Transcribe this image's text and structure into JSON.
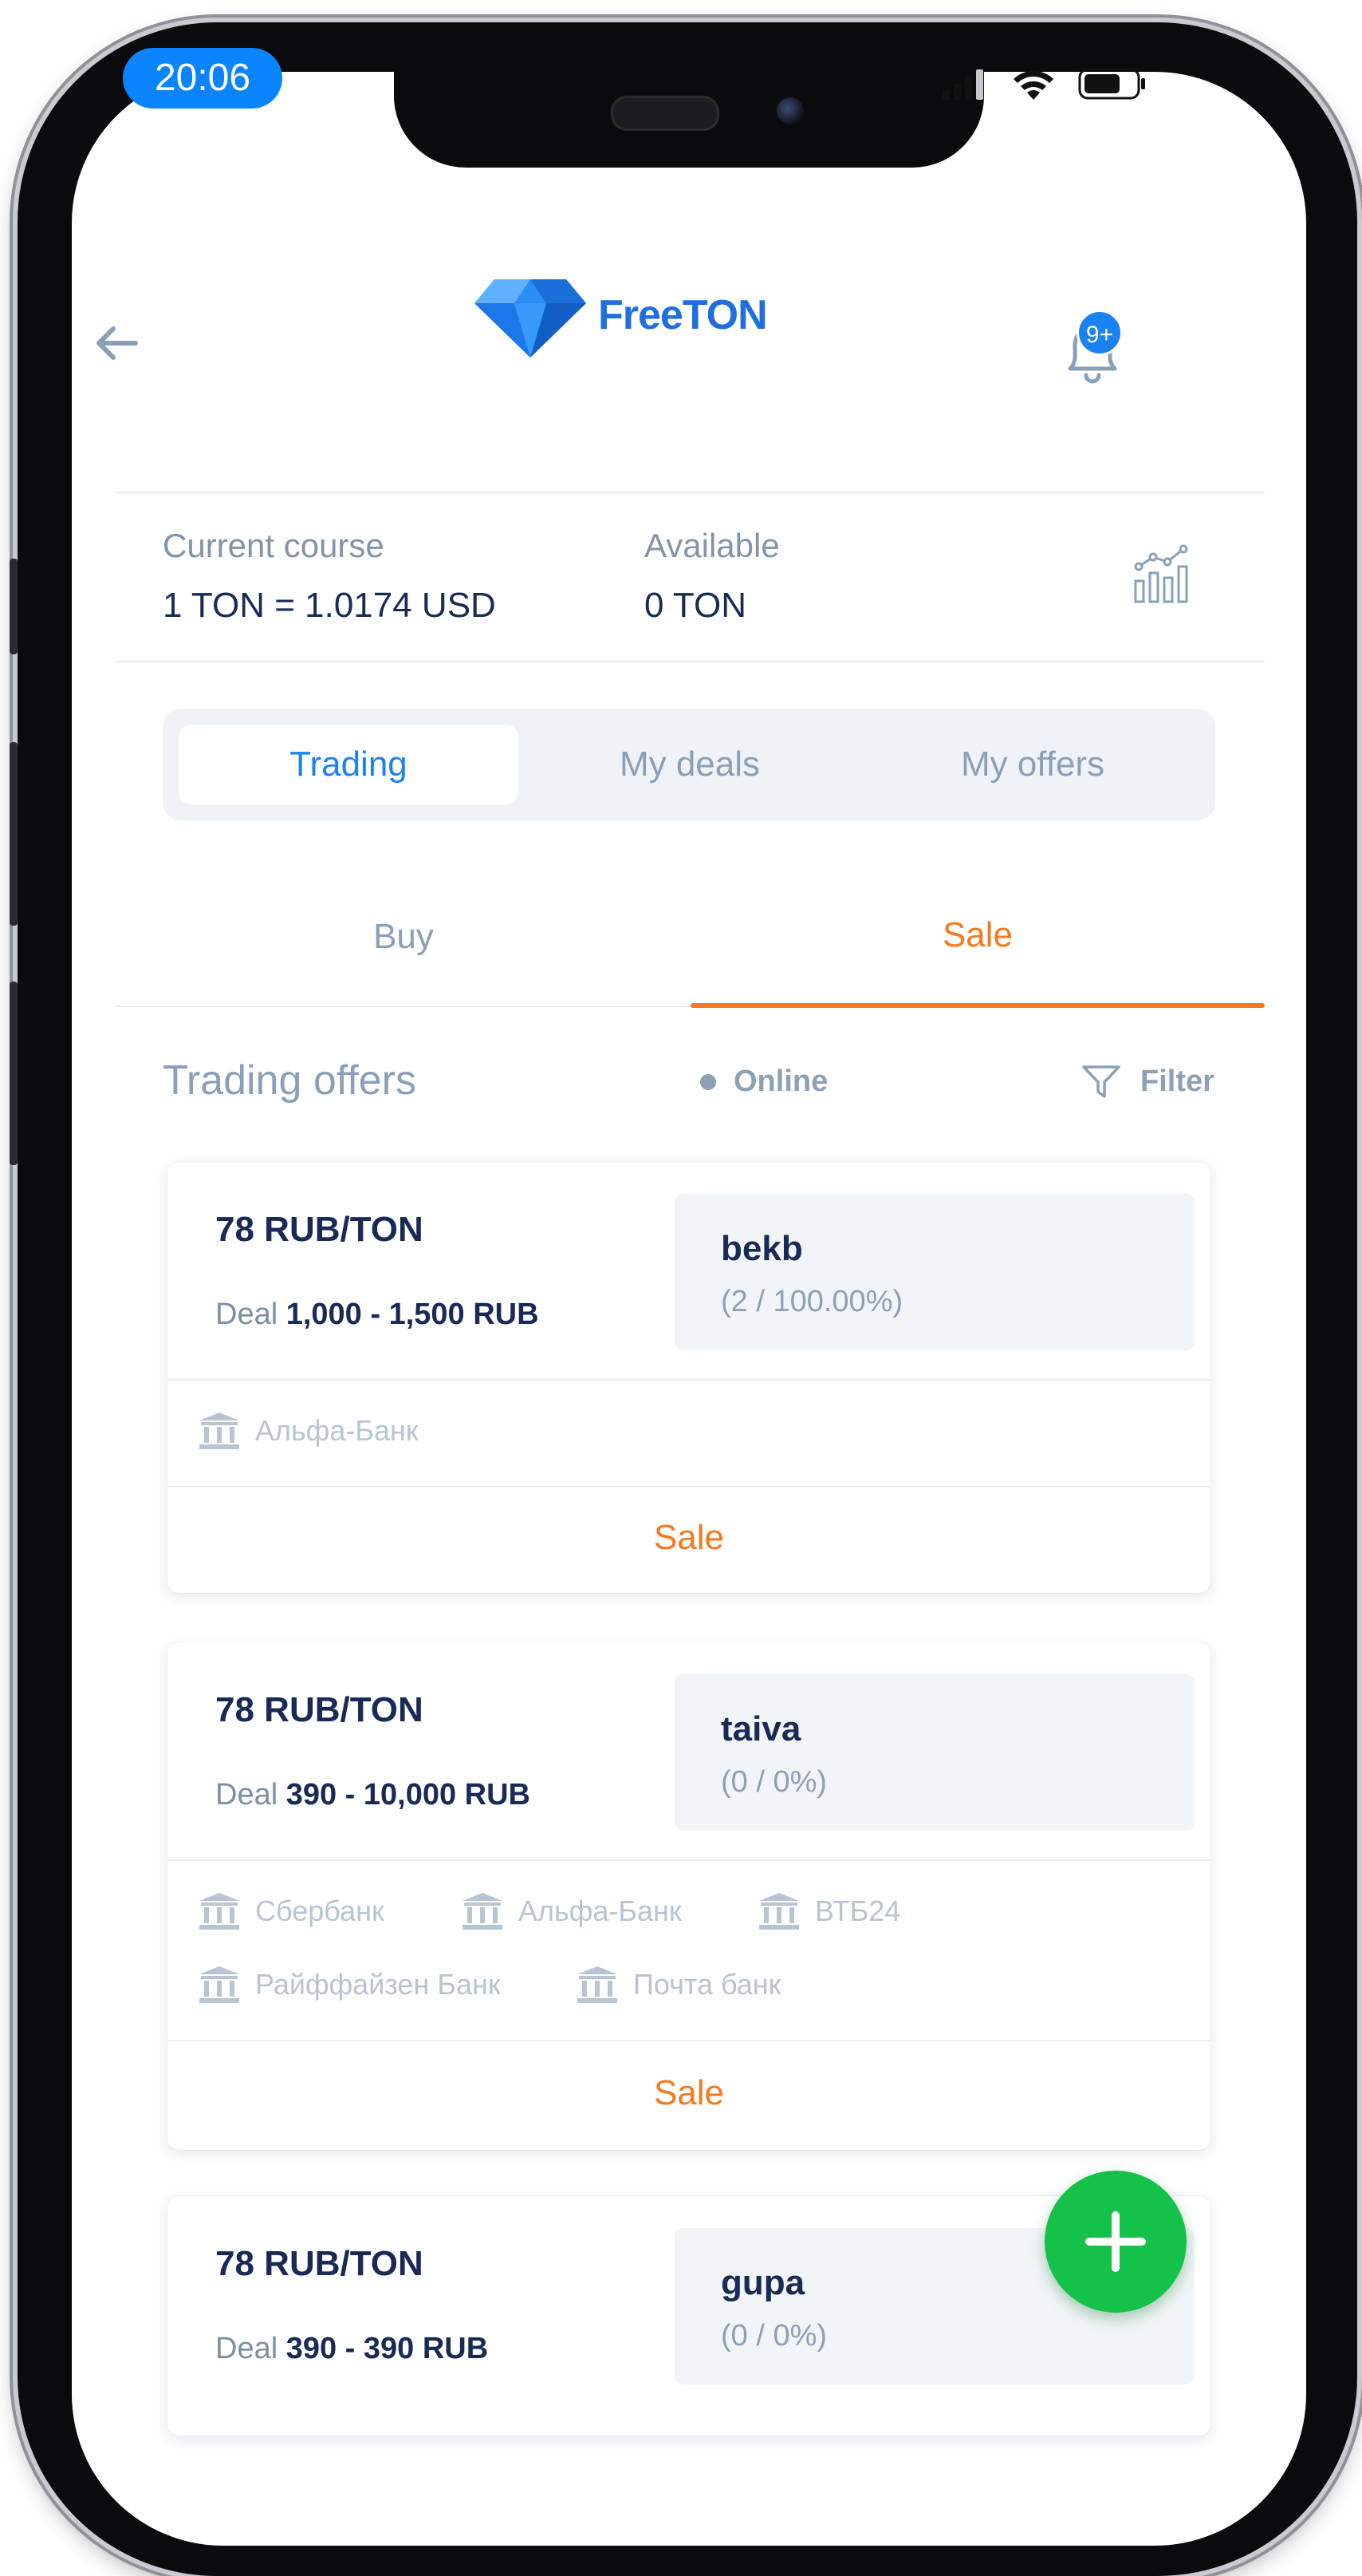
{
  "status_bar": {
    "time": "20:06"
  },
  "header": {
    "brand": "FreeTON",
    "notifications_badge": "9+"
  },
  "course": {
    "current_label": "Current course",
    "current_value": "1 TON = 1.0174 USD",
    "available_label": "Available",
    "available_value": "0 TON"
  },
  "tabs": [
    {
      "label": "Trading",
      "active": true
    },
    {
      "label": "My deals",
      "active": false
    },
    {
      "label": "My offers",
      "active": false
    }
  ],
  "subtabs": [
    {
      "label": "Buy",
      "active": false
    },
    {
      "label": "Sale",
      "active": true
    }
  ],
  "offers_header": {
    "title": "Trading offers",
    "online": "Online",
    "filter": "Filter"
  },
  "offers": [
    {
      "price": "78 RUB/TON",
      "deal_label": "Deal",
      "deal_range": "1,000 - 1,500 RUB",
      "seller": "bekb",
      "stats": "(2 / 100.00%)",
      "banks": [
        "Альфа-Банк"
      ],
      "action": "Sale"
    },
    {
      "price": "78 RUB/TON",
      "deal_label": "Deal",
      "deal_range": "390 - 10,000 RUB",
      "seller": "taiva",
      "stats": "(0 / 0%)",
      "banks": [
        "Сбербанк",
        "Альфа-Банк",
        "ВТБ24",
        "Райффайзен Банк",
        "Почта банк"
      ],
      "action": "Sale"
    },
    {
      "price": "78 RUB/TON",
      "deal_label": "Deal",
      "deal_range": "390 - 390 RUB",
      "seller": "gupa",
      "stats": "(0 / 0%)"
    }
  ],
  "colors": {
    "accent_blue": "#1b82f1",
    "accent_orange": "#f47a20",
    "fab_green": "#14c24a",
    "navy_text": "#1a2a56"
  },
  "icons": [
    "back-arrow-icon",
    "diamond-logo-icon",
    "bell-icon",
    "chart-icon",
    "filter-icon",
    "bank-icon",
    "plus-icon",
    "signal-icon",
    "wifi-icon",
    "battery-icon"
  ]
}
